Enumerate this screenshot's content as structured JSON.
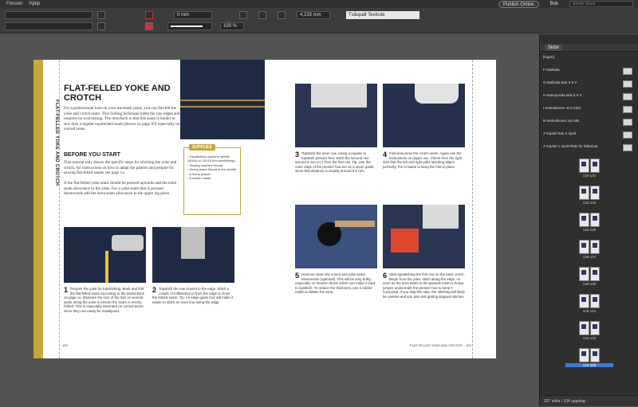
{
  "menu": {
    "items": [
      "Fönster",
      "Hjälp"
    ]
  },
  "topbar": {
    "publish_label": "Publish Online",
    "workspace": "Bok",
    "search_placeholder": "Adobe Stock"
  },
  "control": {
    "stroke_value": "0 mm",
    "opacity_value": "100 %",
    "spacing_value": "4,233 mm",
    "para_style": "Tvåspalt Textrute"
  },
  "left_page": {
    "vertical_title": "FLAT-FELLED YOKE AND CROTCH",
    "title": "FLAT-FELLED YOKE AND CROTCH",
    "intro": "For a professional look on your me-made jeans, you can flat-fell the yoke and crotch seam. This folding technique hides the raw edges and requires no overcasting. The drawback is that this seam is harder to sew than a regular topstitched seam (shown on page XX especially on curved areas.",
    "before_heading": "BEFORE YOU START",
    "before_text": "This tutorial only shows the specific steps for stitching the yoke and crotch, for instructions on how to adapt the pattern and prepare for sewing flat-felled seams see page xx.",
    "before_text2": "If the flat-felled yoke seam should be pressed upwards add the extra seam allowance to the yoke. For a yoke seam that is pressed downwards add the extra seam allowance to the upper leg piece.",
    "supplies_title": "SUPPLIES",
    "supplies": [
      "Topstitching machine needle 100/16 or 110/18 (for topstitching)",
      "Sewing machine thread",
      "Heavy jeans thread in the needle",
      "A hump jumper",
      "A rubber mallet"
    ],
    "step1_num": "1",
    "step1": "Prepare the yoke for topstitching. Mark and fold the flat-felled seam according to the instructions on page xx. Measure the size of the fold on several spots along the yoke to ensure the seam is evenly folded. This is especially important on curved areas since they can easily be misaligned.",
    "step2_num": "2",
    "step2": "Topstitch the row closest to the edge. Stitch a couple of millimetres in from the edge to close the folded seam. Tip: An edge guide foot will make it easier to stitch an even line along the edge.",
    "folio": "102"
  },
  "right_page": {
    "step3_num": "3",
    "step3": "Topstitch the inner row. Using a regular or topstitch presser foot, stitch the second row around 6 mm (¼\") from the first row. Tip: Use the outer edge of the presser foot toe as a seam guide, since that distance is usually around 5-6 mm.",
    "step4_num": "4",
    "step4": "Fold and press the crotch seam. Again use the instructions on pages xxx. Check from the right side that the left and right yoke stitching aligns perfectly. Pin or baste to keep the fold in place.",
    "step5_num": "5",
    "step5": "Hammer down the crotch and yoke seam intersection (optional). This will be very bulky, especially on heavier denim which can make it hard to topstitch. To reduce the thickness, use a rubber mallet to flatten the area.",
    "step6_num": "6",
    "step6": "Start topstitching the first row on the back crotch. Begin from the yoke, stitch along the edge. As soon as the area starts to tilt upwards insert a hump-jumper underneath the presser foot to keep it horizontal. If you skip this step, the stitching will likely be uneven and you also risk getting skipped stitches.",
    "folio_title": "FLAT-FELLED YOKE AND CROTCH",
    "folio": "103"
  },
  "pages_panel": {
    "title": "Sidor",
    "masters": [
      "[Ingen]",
      "F-Mallsida",
      "G-Mallsida Bok 6 9 V",
      "H-Intervjusida Bok 6 9 V",
      "I-Instruktioner 4x4 Guld",
      "B-Instruktioner 4x4 BB",
      "J-Kapitel Bok 2 spalt",
      "J-Kapitel 1 spalt Plats för faktaruta"
    ],
    "pages": [
      "130-131",
      "132-133",
      "134-135",
      "136-137",
      "138-139",
      "140-141",
      "142-143",
      "144-145"
    ],
    "selected": "144-145",
    "footer": "207 sidor i 104 uppslag"
  }
}
